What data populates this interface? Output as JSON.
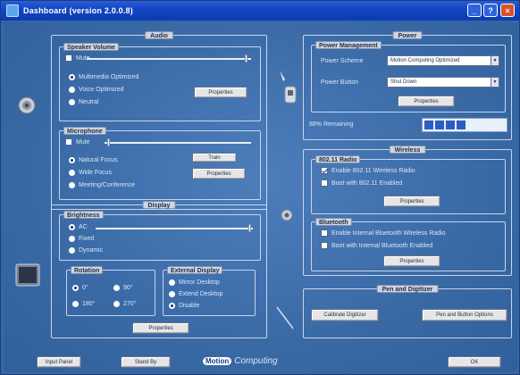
{
  "window": {
    "title": "Dashboard (version 2.0.0.8)",
    "min_glyph": "_",
    "help_glyph": "?",
    "close_glyph": "×"
  },
  "audio": {
    "title": "Audio",
    "speaker": {
      "title": "Speaker Volume",
      "mute_label": "Mute",
      "mute_checked": false,
      "volume_fraction": 0.98,
      "options": [
        "Multimedia Optimized",
        "Voice Optimized",
        "Neutral"
      ],
      "selected_option": 0,
      "properties_label": "Properties"
    },
    "mic": {
      "title": "Microphone",
      "mute_label": "Mute",
      "mute_checked": false,
      "volume_fraction": 0.02,
      "options": [
        "Natural Focus",
        "Wide Focus",
        "Meeting/Conference"
      ],
      "selected_option": 0,
      "train_label": "Train",
      "properties_label": "Properties"
    }
  },
  "display": {
    "title": "Display",
    "brightness": {
      "title": "Brightness",
      "options": [
        "AC",
        "Fixed",
        "Dynamic"
      ],
      "selected_option": 0,
      "level_fraction": 0.99
    },
    "rotation": {
      "title": "Rotation",
      "options": [
        "0°",
        "90°",
        "180°",
        "270°"
      ],
      "selected_option": 0
    },
    "external": {
      "title": "External Display",
      "options": [
        "Mirror Desktop",
        "Extend Desktop",
        "Disable"
      ],
      "selected_option": 2
    },
    "properties_label": "Properties"
  },
  "power": {
    "title": "Power",
    "mgmt_title": "Power Management",
    "scheme_label": "Power Scheme",
    "scheme_value": "Motion Computing Optimized",
    "button_label": "Power Button",
    "button_value": "Shut Down",
    "properties_label": "Properties",
    "battery_label": "88% Remaining",
    "battery_fraction": 0.88
  },
  "wireless": {
    "title": "Wireless",
    "wifi": {
      "title": "802.11 Radio",
      "enable_label": "Enable 802.11 Wireless Radio",
      "enable_checked": true,
      "boot_label": "Boot with 802.11 Enabled",
      "boot_checked": false,
      "properties_label": "Properties"
    },
    "bluetooth": {
      "title": "Bluetooth",
      "enable_label": "Enable Internal Bluetooth Wireless Radio",
      "enable_checked": false,
      "boot_label": "Boot with Internal Bluetooth Enabled",
      "boot_checked": false,
      "properties_label": "Properties"
    }
  },
  "pen": {
    "title": "Pen and Digitizer",
    "calibrate_label": "Calibrate Digitizer",
    "options_label": "Pen and Button Options"
  },
  "footer": {
    "input_panel_label": "Input Panel",
    "stand_by_label": "Stand By",
    "brand_prefix": "Motion",
    "brand_suffix": "Computing",
    "ok_label": "OK"
  },
  "colors": {
    "background": "#3d6eaa",
    "titlebar": "#1346c4",
    "accent": "#2a5cc4"
  }
}
